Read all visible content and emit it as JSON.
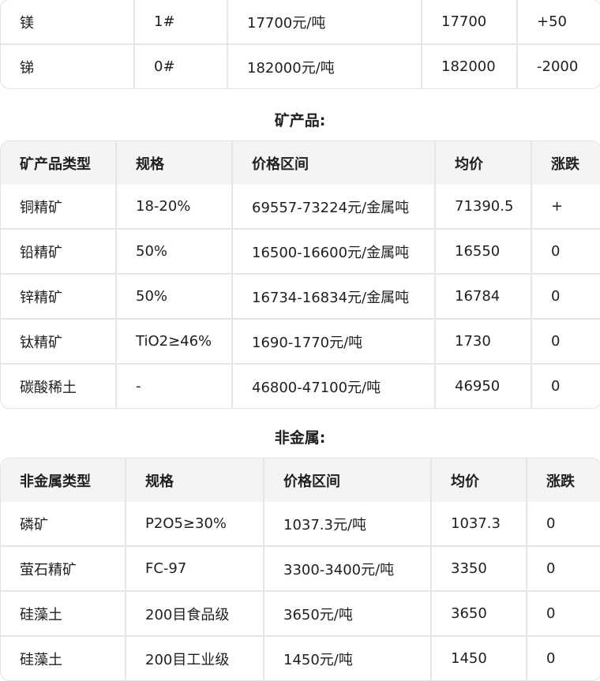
{
  "metals": {
    "rows": [
      {
        "name": "镁",
        "spec": "1#",
        "price": "17700元/吨",
        "avg": "17700",
        "change": "+50"
      },
      {
        "name": "锑",
        "spec": "0#",
        "price": "182000元/吨",
        "avg": "182000",
        "change": "-2000"
      }
    ]
  },
  "ore": {
    "title": "矿产品:",
    "headers": [
      "矿产品类型",
      "规格",
      "价格区间",
      "均价",
      "涨跌"
    ],
    "rows": [
      {
        "name": "铜精矿",
        "spec": "18-20%",
        "price": "69557-73224元/金属吨",
        "avg": "71390.5",
        "change": "+"
      },
      {
        "name": "铅精矿",
        "spec": "50%",
        "price": "16500-16600元/金属吨",
        "avg": "16550",
        "change": "0"
      },
      {
        "name": "锌精矿",
        "spec": "50%",
        "price": "16734-16834元/金属吨",
        "avg": "16784",
        "change": "0"
      },
      {
        "name": "钛精矿",
        "spec": "TiO2≥46%",
        "price": "1690-1770元/吨",
        "avg": "1730",
        "change": "0"
      },
      {
        "name": "碳酸稀土",
        "spec": "-",
        "price": "46800-47100元/吨",
        "avg": "46950",
        "change": "0"
      }
    ]
  },
  "nonmetal": {
    "title": "非金属:",
    "headers": [
      "非金属类型",
      "规格",
      "价格区间",
      "均价",
      "涨跌"
    ],
    "rows": [
      {
        "name": "磷矿",
        "spec": "P2O5≥30%",
        "price": "1037.3元/吨",
        "avg": "1037.3",
        "change": "0"
      },
      {
        "name": "萤石精矿",
        "spec": "FC-97",
        "price": "3300-3400元/吨",
        "avg": "3350",
        "change": "0"
      },
      {
        "name": "硅藻土",
        "spec": "200目食品级",
        "price": "3650元/吨",
        "avg": "3650",
        "change": "0"
      },
      {
        "name": "硅藻土",
        "spec": "200目工业级",
        "price": "1450元/吨",
        "avg": "1450",
        "change": "0"
      }
    ]
  }
}
